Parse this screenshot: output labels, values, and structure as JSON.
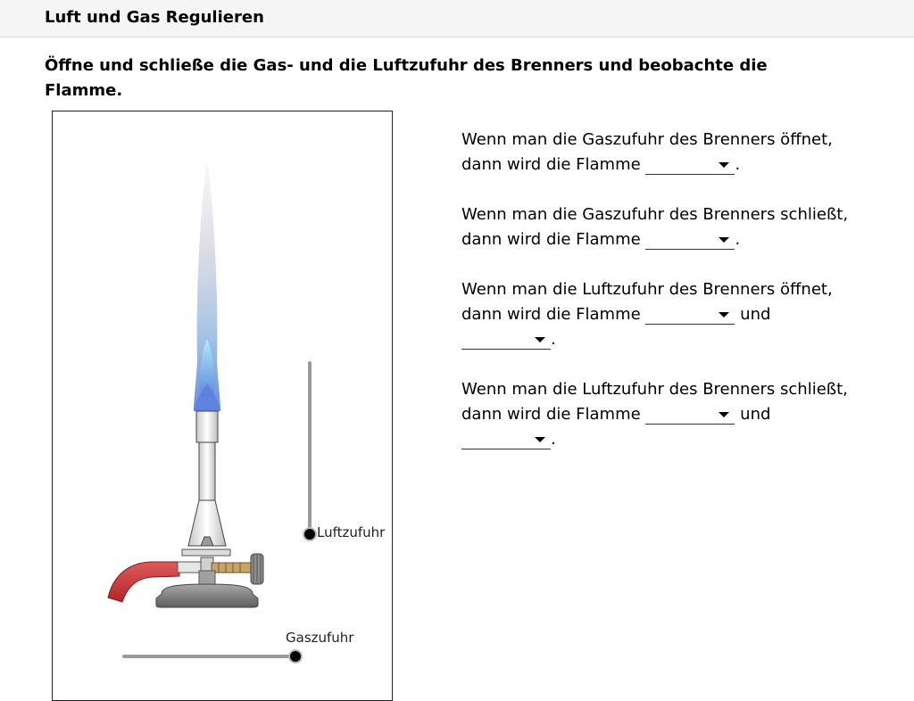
{
  "header": {
    "title": "Luft und Gas Regulieren"
  },
  "instruction": "Öffne und schließe die Gas- und die Luftzufuhr des Brenners und beobachte die Flamme.",
  "simulation": {
    "air_slider": {
      "label": "Luftzufuhr",
      "value": 0
    },
    "gas_slider": {
      "label": "Gaszufuhr",
      "value": 1
    }
  },
  "questions": [
    {
      "line1": "Wenn man die Gaszufuhr des Brenners öffnet,",
      "line2_prefix": "dann wird die Flamme",
      "end": ".",
      "dropdown": {
        "value": ""
      }
    },
    {
      "line1": "Wenn man die Gaszufuhr des Brenners schließt,",
      "line2_prefix": "dann wird die Flamme",
      "end": ".",
      "dropdown": {
        "value": ""
      }
    },
    {
      "line1": "Wenn man die Luftzufuhr des Brenners öffnet,",
      "line2_prefix": "dann wird die Flamme",
      "conj": "und",
      "end": ".",
      "dropdown": {
        "value": ""
      },
      "dropdown2": {
        "value": ""
      }
    },
    {
      "line1": "Wenn man die Luftzufuhr des Brenners schließt,",
      "line2_prefix": "dann wird die Flamme",
      "conj": "und",
      "end": ".",
      "dropdown": {
        "value": ""
      },
      "dropdown2": {
        "value": ""
      }
    }
  ]
}
